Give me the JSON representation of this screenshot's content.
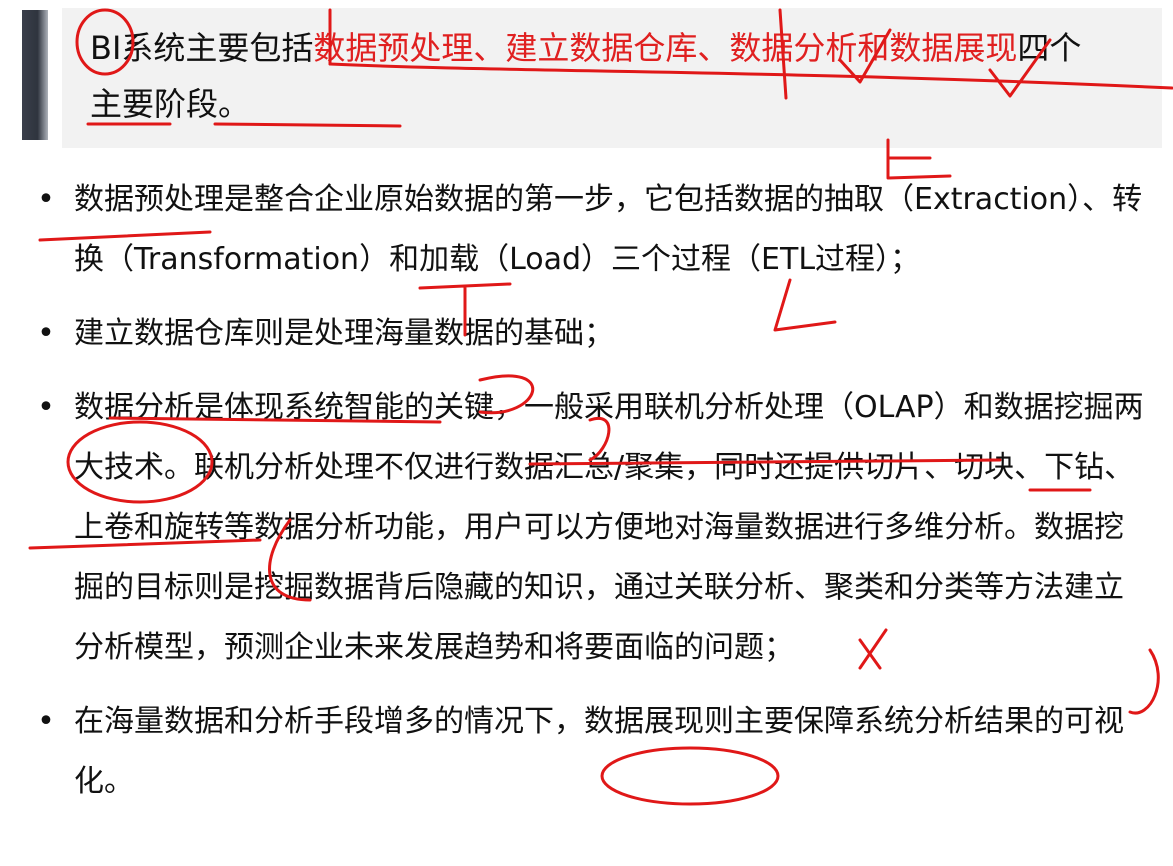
{
  "title": {
    "part1": "BI系统主要包括",
    "highlight": "数据预处理、建立数据仓库、数据分析和数据展现",
    "part2": "四个主要阶段。"
  },
  "bullets": [
    {
      "marker": "•",
      "text": "数据预处理是整合企业原始数据的第一步，它包括数据的抽取（Extraction）、转换（Transformation）和加载（Load）三个过程（ETL过程）；"
    },
    {
      "marker": "•",
      "text": "建立数据仓库则是处理海量数据的基础；"
    },
    {
      "marker": "•",
      "text": "数据分析是体现系统智能的关键，一般采用联机分析处理（OLAP）和数据挖掘两大技术。联机分析处理不仅进行数据汇总/聚集，同时还提供切片、切块、下钻、上卷和旋转等数据分析功能，用户可以方便地对海量数据进行多维分析。数据挖掘的目标则是挖掘数据背后隐藏的知识，通过关联分析、聚类和分类等方法建立分析模型，预测企业未来发展趋势和将要面临的问题；"
    },
    {
      "marker": "•",
      "text": "在海量数据和分析手段增多的情况下，数据展现则主要保障系统分析结果的可视化。"
    }
  ],
  "colors": {
    "highlight": "#e02020",
    "ink": "#e01818",
    "bar": "#2f343e"
  }
}
